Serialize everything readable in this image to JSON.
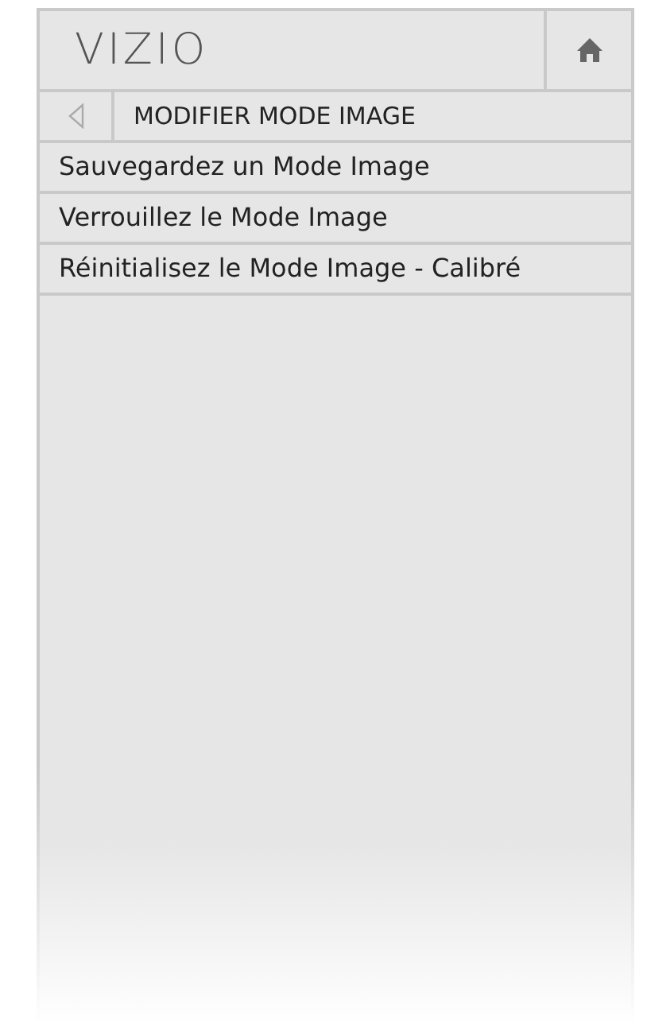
{
  "logo": "VIZIO",
  "title": "MODIFIER MODE IMAGE",
  "items": [
    {
      "label": "Sauvegardez un Mode Image"
    },
    {
      "label": "Verrouillez le Mode Image"
    },
    {
      "label": "Réinitialisez le Mode Image - Calibré"
    }
  ]
}
